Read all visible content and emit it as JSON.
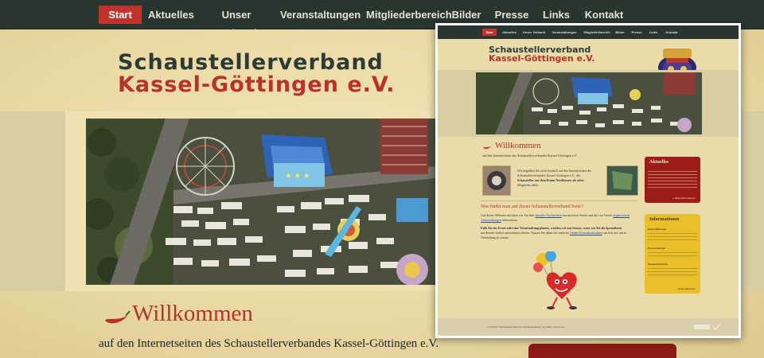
{
  "nav": {
    "items": [
      {
        "label": "Start",
        "active": true
      },
      {
        "label": "Aktuelles",
        "active": false
      },
      {
        "label": "Unser Verband",
        "active": false
      },
      {
        "label": "Veranstaltungen",
        "active": false
      },
      {
        "label": "Mitgliederbereich",
        "active": false
      },
      {
        "label": "Bilder",
        "active": false
      },
      {
        "label": "Presse",
        "active": false
      },
      {
        "label": "Links",
        "active": false
      },
      {
        "label": "Kontakt",
        "active": false
      }
    ]
  },
  "header": {
    "logo_line1": "Schaustellerverband",
    "logo_line2": "Kassel-Göttingen e.V."
  },
  "main": {
    "welcome_title": "Willkommen",
    "welcome_sub": "auf den Internetseiten des Schaustellerverbandes Kassel-Göttingen e.V."
  },
  "preview": {
    "welcome_title": "Willkommen",
    "welcome_sub": "auf den Internetseiten des Schaustellerverbandes Kassel-Göttingen e.V.",
    "intro_1": "Wir begrüßen Sie recht herzlich auf den Internetseiten des",
    "intro_2": "Schaustellerverbandes Kassel-Göttingen e.V., der",
    "intro_3": "Schausteller aus dem Raum Nordhessen als seine",
    "intro_4": "Mitglieder zählt.",
    "section_title": "Was findet man auf dieser Schaustellerverband Seite?",
    "p1_1": "Auf dieser Webseite möchten wir Sie über",
    "p1_link1": "aktuelle Nachrichten",
    "p1_2": "aus unserem Verein und die von Verein",
    "p1_link2": "organisierten",
    "p1_3": "Veranstaltungen",
    "p1_4": "informieren.",
    "p2_1": "Falls Sie ein Event oder eine Veranstaltung planen, würden wir uns freuen, wenn wir Sie als Spezialisten",
    "p2_2": "auf diesem Gebiet unterstützen dürfen. Nutzen Sie dabei die einfache",
    "p2_link": "Online-Kontaktaufnahme",
    "p2_3": "um sich mit uns in",
    "p2_4": "Verbindung zu setzen.",
    "aktuelles_title": "Aktuelles",
    "aktuelles_more": "» Mehr Informationen",
    "info_title": "Informationen",
    "info_h1": "Veranstaltungen",
    "info_h2": "Pressematerial",
    "info_h3": "Verbandsstruktur",
    "info_more": "Verbandsstruktur",
    "footer": "© 2013 für Schaustellerverband  |  Verbandssatzung  |  Kontakt  |  Impressum"
  },
  "colors": {
    "nav_bg": "#28362f",
    "accent_red": "#c2312c",
    "logo_dark": "#2d3b34",
    "logo_red": "#b7322b",
    "parchment": "#e8d9a6",
    "info_yellow": "#e9c02b",
    "aktuelles_red": "#9b1c18"
  },
  "icons": {
    "welcome": "chili-pepper-icon",
    "badge": "fair-ride-logo",
    "mascot": "heart-mascot-with-balloons"
  }
}
